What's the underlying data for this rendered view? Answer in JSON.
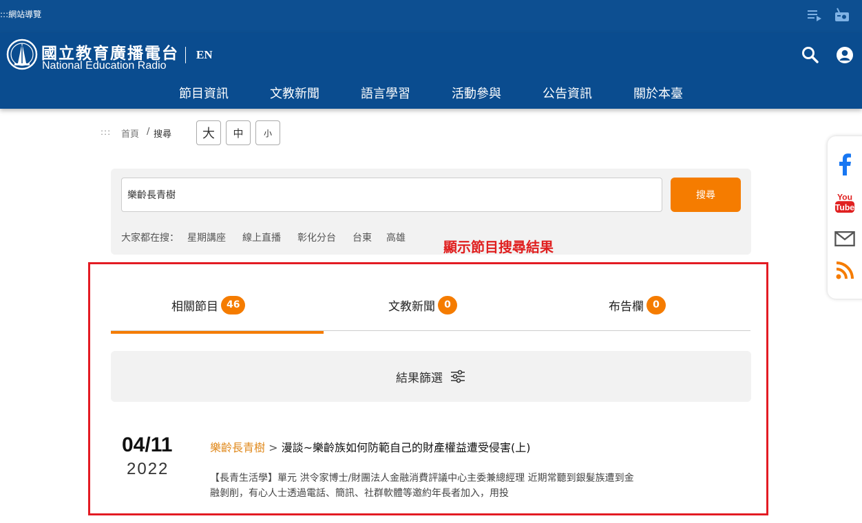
{
  "topbar": {
    "site_nav": ":::網站導覽",
    "playlist_icon": "playlist-icon",
    "radio_icon": "radio-icon"
  },
  "header": {
    "logo_zh": "國立教育廣播電台",
    "logo_en": "National Education Radio",
    "lang": "EN",
    "search_icon": "search-icon",
    "user_icon": "user-icon",
    "nav": [
      "節目資訊",
      "文教新聞",
      "語言學習",
      "活動參與",
      "公告資訊",
      "關於本臺"
    ]
  },
  "breadcrumb": {
    "dots": ":::",
    "home": "首頁",
    "sep": "/",
    "current": "搜尋"
  },
  "font_size": {
    "large": "大",
    "medium": "中",
    "small": "小"
  },
  "search": {
    "value": "樂齡長青樹",
    "button": "搜尋",
    "hot_label": "大家都在搜：",
    "hot": [
      "星期講座",
      "線上直播",
      "彰化分台",
      "台東",
      "高雄"
    ]
  },
  "annotation": "顯示節目搜尋結果",
  "tabs": [
    {
      "label": "相關節目",
      "count": "46"
    },
    {
      "label": "文教新聞",
      "count": "0"
    },
    {
      "label": "布告欄",
      "count": "0"
    }
  ],
  "filter": {
    "label": "結果篩選",
    "icon": "sliders-icon"
  },
  "results": [
    {
      "date_md": "04/11",
      "year": "2022",
      "program": "樂齡長青樹",
      "separator": " > ",
      "title": "漫談~樂齡族如何防範自己的財產權益遭受侵害(上)",
      "desc": "【長青生活學】單元 洪令家博士/財團法人金融消費評議中心主委兼總經理 近期常聽到銀髮族遭到金融剝削，有心人士透過電話、簡訊、社群軟體等邀約年長者加入，用投"
    }
  ],
  "social": [
    "facebook-icon",
    "youtube-icon",
    "mail-icon",
    "rss-icon"
  ],
  "colors": {
    "primary": "#0a4c8f",
    "accent": "#f57c00",
    "annotation": "#e31b23"
  }
}
